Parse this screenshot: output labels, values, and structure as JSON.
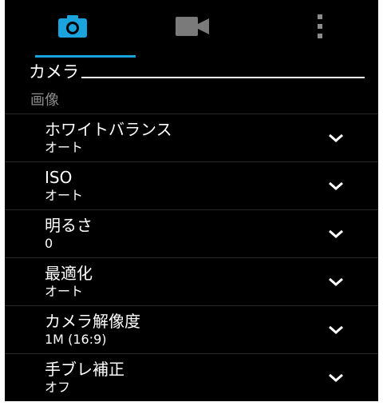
{
  "tabs": [
    {
      "icon": "camera-icon",
      "active": true
    },
    {
      "icon": "video-icon",
      "active": false
    },
    {
      "icon": "more-vert-icon",
      "active": false
    }
  ],
  "colors": {
    "accent": "#1ba3dd",
    "background": "#000000",
    "category_text": "#8c8c8c"
  },
  "section": {
    "title": "カメラ"
  },
  "category": {
    "title": "画像"
  },
  "settings": [
    {
      "label": "ホワイトバランス",
      "value": "オート"
    },
    {
      "label": "ISO",
      "value": "オート"
    },
    {
      "label": "明るさ",
      "value": "0"
    },
    {
      "label": "最適化",
      "value": "オート"
    },
    {
      "label": "カメラ解像度",
      "value": "1M (16:9)"
    },
    {
      "label": "手ブレ補正",
      "value": "オフ"
    }
  ]
}
